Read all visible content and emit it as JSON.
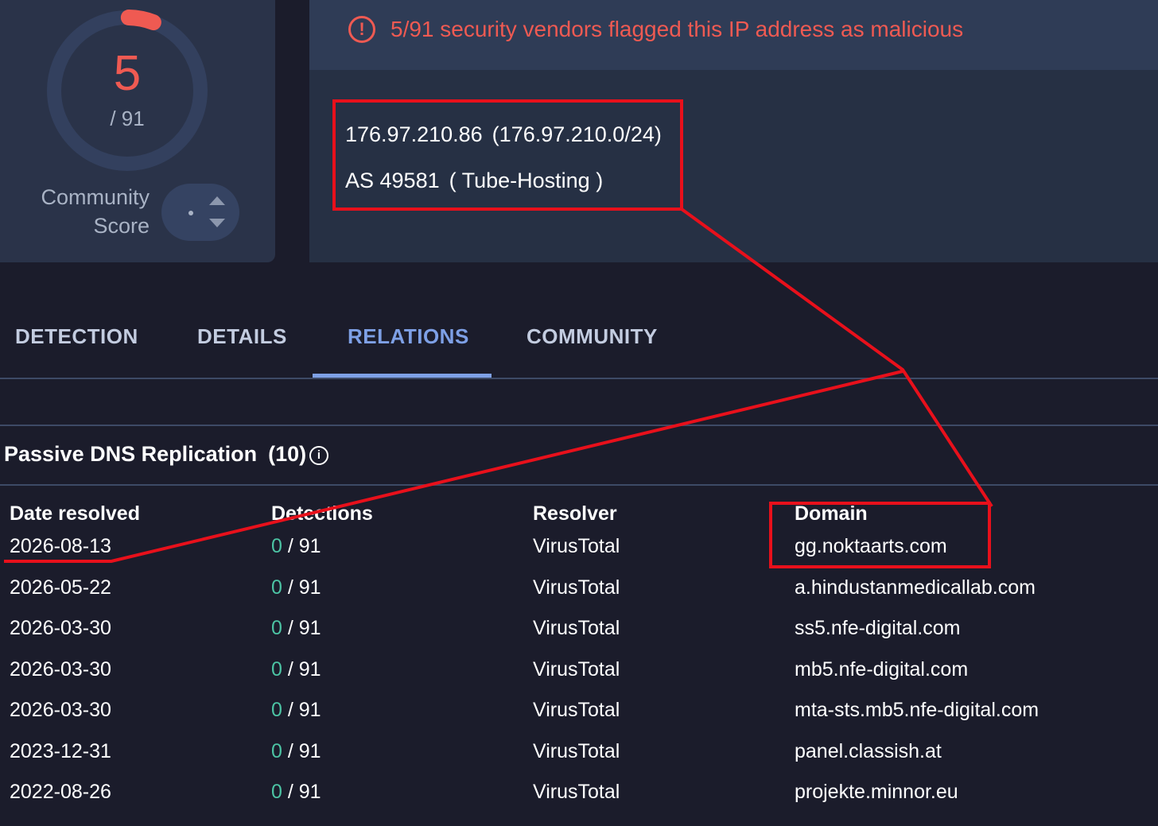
{
  "score": {
    "value": "5",
    "total": "/ 91",
    "community_label_line1": "Community",
    "community_label_line2": "Score",
    "ring_fraction": 0.055
  },
  "alert": {
    "icon": "exclamation-circle-icon",
    "text": "5/91 security vendors flagged this IP address as malicious"
  },
  "ip_info": {
    "ip": "176.97.210.86",
    "network": "(176.97.210.0/24)",
    "asn": "AS 49581",
    "as_owner": "( Tube-Hosting )"
  },
  "tabs": [
    {
      "label": "DETECTION",
      "active": false
    },
    {
      "label": "DETAILS",
      "active": false
    },
    {
      "label": "RELATIONS",
      "active": true
    },
    {
      "label": "COMMUNITY",
      "active": false
    }
  ],
  "passive_dns": {
    "title": "Passive DNS Replication",
    "count": "(10)",
    "columns": [
      "Date resolved",
      "Detections",
      "Resolver",
      "Domain"
    ],
    "rows": [
      {
        "date": "2026-08-13",
        "det_pos": "0",
        "det_total": "/ 91",
        "resolver": "VirusTotal",
        "domain": "gg.noktaarts.com"
      },
      {
        "date": "2026-05-22",
        "det_pos": "0",
        "det_total": "/ 91",
        "resolver": "VirusTotal",
        "domain": "a.hindustanmedicallab.com"
      },
      {
        "date": "2026-03-30",
        "det_pos": "0",
        "det_total": "/ 91",
        "resolver": "VirusTotal",
        "domain": "ss5.nfe-digital.com"
      },
      {
        "date": "2026-03-30",
        "det_pos": "0",
        "det_total": "/ 91",
        "resolver": "VirusTotal",
        "domain": "mb5.nfe-digital.com"
      },
      {
        "date": "2026-03-30",
        "det_pos": "0",
        "det_total": "/ 91",
        "resolver": "VirusTotal",
        "domain": "mta-sts.mb5.nfe-digital.com"
      },
      {
        "date": "2023-12-31",
        "det_pos": "0",
        "det_total": "/ 91",
        "resolver": "VirusTotal",
        "domain": "panel.classish.at"
      },
      {
        "date": "2022-08-26",
        "det_pos": "0",
        "det_total": "/ 91",
        "resolver": "VirusTotal",
        "domain": "projekte.minnor.eu"
      }
    ]
  },
  "colors": {
    "background": "#1b1c2b",
    "card": "#2a3349",
    "malicious": "#ef5a52",
    "active_tab": "#7ea0e6",
    "clean": "#4cc4a4",
    "annotation": "#e8101b"
  }
}
